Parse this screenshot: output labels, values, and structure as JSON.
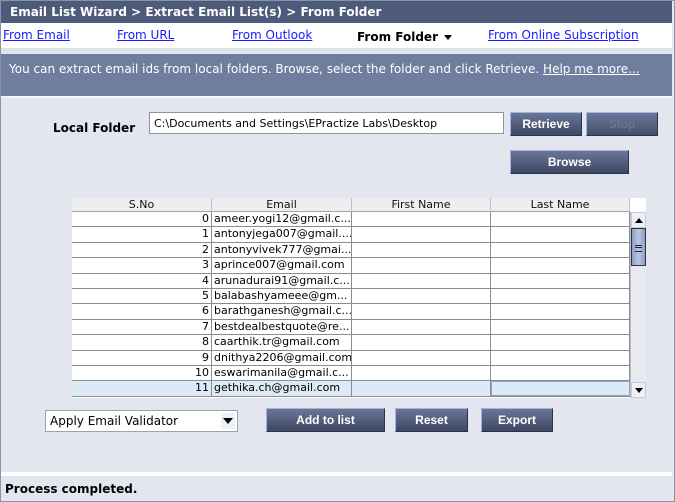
{
  "title": "Email List Wizard > Extract Email List(s) > From Folder",
  "tabs": [
    {
      "label": "From Email",
      "active": false
    },
    {
      "label": "From URL",
      "active": false
    },
    {
      "label": "From Outlook",
      "active": false
    },
    {
      "label": "From Folder",
      "active": true
    },
    {
      "label": "From Online Subscription",
      "active": false
    }
  ],
  "info": {
    "text": "You can extract email ids from local folders. Browse, select the folder and click Retrieve.",
    "help_link": "Help me more..."
  },
  "local_folder": {
    "label": "Local Folder",
    "value": "C:\\Documents and Settings\\EPractize Labs\\Desktop"
  },
  "buttons": {
    "retrieve": "Retrieve",
    "stop": "Stop",
    "browse": "Browse",
    "add_to_list": "Add to list",
    "reset": "Reset",
    "export": "Export"
  },
  "table": {
    "columns": [
      "S.No",
      "Email",
      "First Name",
      "Last Name"
    ],
    "rows": [
      {
        "sno": "0",
        "email": "ameer.yogi12@gmail.c...",
        "first": "",
        "last": ""
      },
      {
        "sno": "1",
        "email": "antonyjega007@gmail....",
        "first": "",
        "last": ""
      },
      {
        "sno": "2",
        "email": "antonyvivek777@gmai...",
        "first": "",
        "last": ""
      },
      {
        "sno": "3",
        "email": "aprince007@gmail.com",
        "first": "",
        "last": ""
      },
      {
        "sno": "4",
        "email": "arunadurai91@gmail.c...",
        "first": "",
        "last": ""
      },
      {
        "sno": "5",
        "email": "balabashyameee@gm...",
        "first": "",
        "last": ""
      },
      {
        "sno": "6",
        "email": "barathganesh@gmail.c...",
        "first": "",
        "last": ""
      },
      {
        "sno": "7",
        "email": "bestdealbestquote@re...",
        "first": "",
        "last": ""
      },
      {
        "sno": "8",
        "email": "caarthik.tr@gmail.com",
        "first": "",
        "last": ""
      },
      {
        "sno": "9",
        "email": "dnithya2206@gmail.com",
        "first": "",
        "last": ""
      },
      {
        "sno": "10",
        "email": "eswarimanila@gmail.c...",
        "first": "",
        "last": ""
      },
      {
        "sno": "11",
        "email": "gethika.ch@gmail.com",
        "first": "",
        "last": ""
      }
    ],
    "selected_row": 11
  },
  "validator": {
    "selected": "Apply Email Validator"
  },
  "status": "Process completed."
}
